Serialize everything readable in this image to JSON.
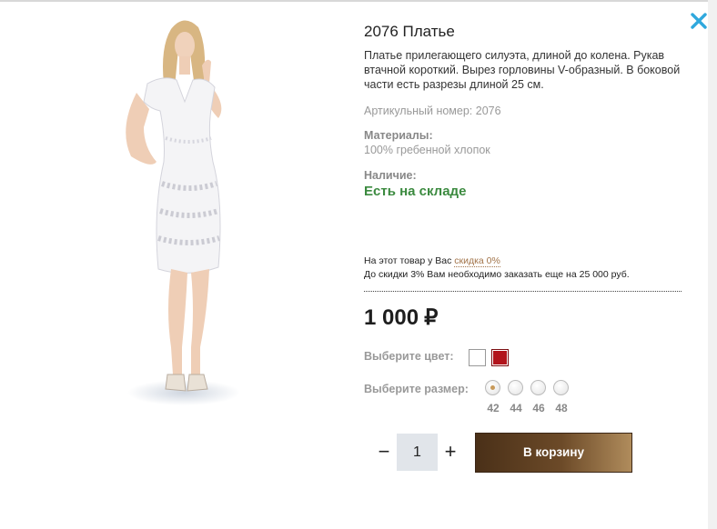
{
  "product": {
    "title": "2076 Платье",
    "description": "Платье прилегающего силуэта, длиной до колена. Рукав втачной короткий. Вырез горловины V-образный. В боковой части есть разрезы длиной 25 см.",
    "sku_text": "Артикульный номер: 2076",
    "materials_label": "Материалы:",
    "materials_value": "100% гребенной хлопок",
    "availability_label": "Наличие:",
    "availability_value": "Есть на складе"
  },
  "discount": {
    "line1_prefix": "На этот товар у Вас ",
    "line1_link": "скидка 0%",
    "line2": "До скидки 3% Вам необходимо заказать еще на 25 000 руб."
  },
  "price": {
    "amount": "1 000",
    "currency": "₽"
  },
  "color": {
    "label": "Выберите цвет:",
    "swatches": [
      "#ffffff",
      "#b2141c"
    ]
  },
  "size": {
    "label": "Выберите размер:",
    "options": [
      "42",
      "44",
      "46",
      "48"
    ],
    "selected": "42"
  },
  "quantity": {
    "minus": "−",
    "value": "1",
    "plus": "+"
  },
  "cart_button": "В корзину",
  "icons": {
    "close": "close-icon"
  },
  "colors": {
    "accent": "#2fa8dd",
    "in_stock": "#3b8a3f",
    "button": "#5b3c20"
  }
}
